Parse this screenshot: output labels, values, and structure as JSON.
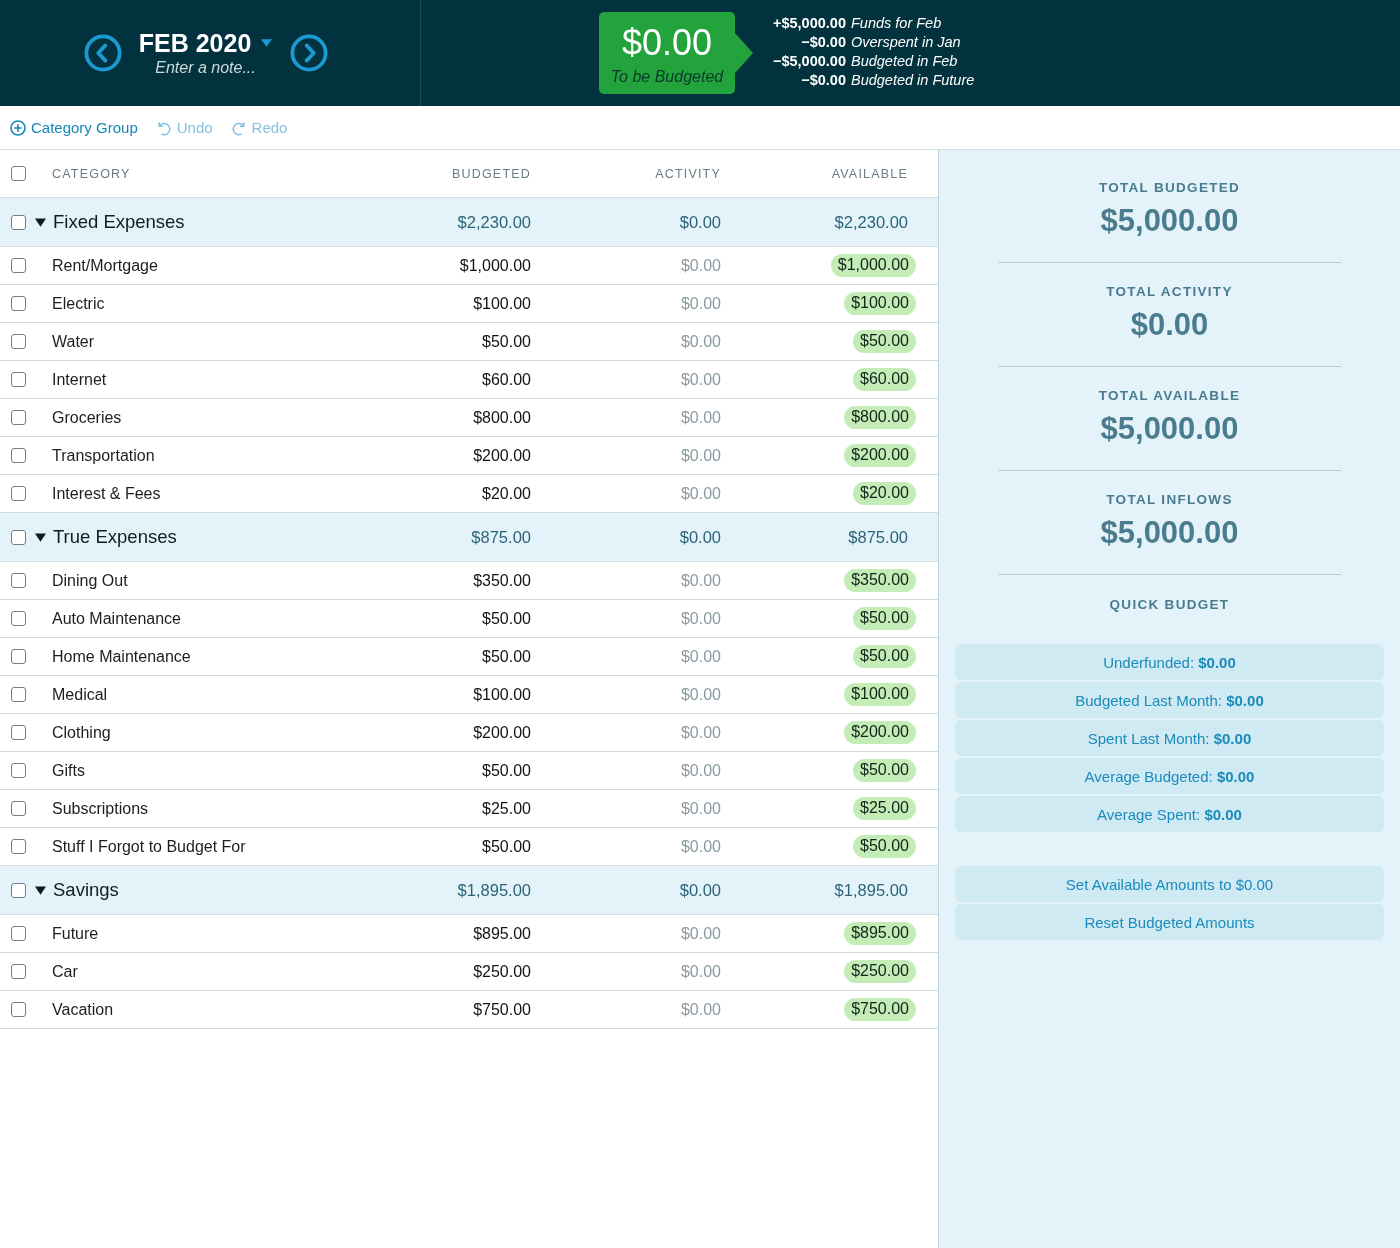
{
  "header": {
    "month": "FEB 2020",
    "note_placeholder": "Enter a note...",
    "to_be_budgeted": {
      "amount": "$0.00",
      "label": "To be Budgeted"
    },
    "summary": [
      {
        "amount": "+$5,000.00",
        "label": "Funds for Feb"
      },
      {
        "amount": "−$0.00",
        "label": "Overspent in Jan"
      },
      {
        "amount": "−$5,000.00",
        "label": "Budgeted in Feb"
      },
      {
        "amount": "−$0.00",
        "label": "Budgeted in Future"
      }
    ]
  },
  "toolbar": [
    {
      "kind": "add",
      "label": "Category Group",
      "disabled": false
    },
    {
      "kind": "undo",
      "label": "Undo",
      "disabled": true
    },
    {
      "kind": "redo",
      "label": "Redo",
      "disabled": true
    }
  ],
  "table": {
    "columns": [
      "CATEGORY",
      "BUDGETED",
      "ACTIVITY",
      "AVAILABLE"
    ],
    "select_all_checked": false,
    "groups": [
      {
        "name": "Fixed Expenses",
        "checked": false,
        "expanded": true,
        "budgeted": "$2,230.00",
        "activity": "$0.00",
        "available": "$2,230.00",
        "categories": [
          {
            "name": "Rent/Mortgage",
            "checked": false,
            "budgeted": "$1,000.00",
            "activity": "$0.00",
            "available": "$1,000.00"
          },
          {
            "name": "Electric",
            "checked": false,
            "budgeted": "$100.00",
            "activity": "$0.00",
            "available": "$100.00"
          },
          {
            "name": "Water",
            "checked": false,
            "budgeted": "$50.00",
            "activity": "$0.00",
            "available": "$50.00"
          },
          {
            "name": "Internet",
            "checked": false,
            "budgeted": "$60.00",
            "activity": "$0.00",
            "available": "$60.00"
          },
          {
            "name": "Groceries",
            "checked": false,
            "budgeted": "$800.00",
            "activity": "$0.00",
            "available": "$800.00"
          },
          {
            "name": "Transportation",
            "checked": false,
            "budgeted": "$200.00",
            "activity": "$0.00",
            "available": "$200.00"
          },
          {
            "name": "Interest & Fees",
            "checked": false,
            "budgeted": "$20.00",
            "activity": "$0.00",
            "available": "$20.00"
          }
        ]
      },
      {
        "name": "True Expenses",
        "checked": false,
        "expanded": true,
        "budgeted": "$875.00",
        "activity": "$0.00",
        "available": "$875.00",
        "categories": [
          {
            "name": "Dining Out",
            "checked": false,
            "budgeted": "$350.00",
            "activity": "$0.00",
            "available": "$350.00"
          },
          {
            "name": "Auto Maintenance",
            "checked": false,
            "budgeted": "$50.00",
            "activity": "$0.00",
            "available": "$50.00"
          },
          {
            "name": "Home Maintenance",
            "checked": false,
            "budgeted": "$50.00",
            "activity": "$0.00",
            "available": "$50.00"
          },
          {
            "name": "Medical",
            "checked": false,
            "budgeted": "$100.00",
            "activity": "$0.00",
            "available": "$100.00"
          },
          {
            "name": "Clothing",
            "checked": false,
            "budgeted": "$200.00",
            "activity": "$0.00",
            "available": "$200.00"
          },
          {
            "name": "Gifts",
            "checked": false,
            "budgeted": "$50.00",
            "activity": "$0.00",
            "available": "$50.00"
          },
          {
            "name": "Subscriptions",
            "checked": false,
            "budgeted": "$25.00",
            "activity": "$0.00",
            "available": "$25.00"
          },
          {
            "name": "Stuff I Forgot to Budget For",
            "checked": false,
            "budgeted": "$50.00",
            "activity": "$0.00",
            "available": "$50.00"
          }
        ]
      },
      {
        "name": "Savings",
        "checked": false,
        "expanded": true,
        "budgeted": "$1,895.00",
        "activity": "$0.00",
        "available": "$1,895.00",
        "categories": [
          {
            "name": "Future",
            "checked": false,
            "budgeted": "$895.00",
            "activity": "$0.00",
            "available": "$895.00"
          },
          {
            "name": "Car",
            "checked": false,
            "budgeted": "$250.00",
            "activity": "$0.00",
            "available": "$250.00"
          },
          {
            "name": "Vacation",
            "checked": false,
            "budgeted": "$750.00",
            "activity": "$0.00",
            "available": "$750.00"
          }
        ]
      }
    ]
  },
  "sidebar": {
    "totals": [
      {
        "label": "TOTAL BUDGETED",
        "value": "$5,000.00"
      },
      {
        "label": "TOTAL ACTIVITY",
        "value": "$0.00"
      },
      {
        "label": "TOTAL AVAILABLE",
        "value": "$5,000.00"
      },
      {
        "label": "TOTAL INFLOWS",
        "value": "$5,000.00"
      }
    ],
    "quick_budget": {
      "title": "QUICK BUDGET",
      "options": [
        "Underfunded: **$0.00**",
        "Budgeted Last Month: **$0.00**",
        "Spent Last Month: **$0.00**",
        "Average Budgeted: **$0.00**",
        "Average Spent: **$0.00**"
      ]
    },
    "actions": [
      "Set Available Amounts to $0.00",
      "Reset Budgeted Amounts"
    ]
  }
}
